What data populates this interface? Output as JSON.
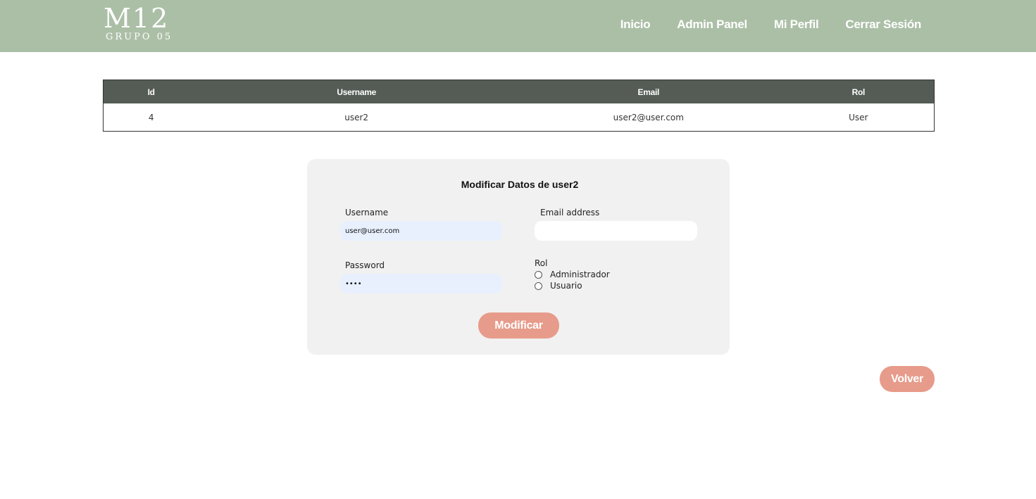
{
  "header": {
    "logo_main": "M12",
    "logo_sub": "GRUPO 05",
    "nav": [
      "Inicio",
      "Admin Panel",
      "Mi Perfil",
      "Cerrar Sesión"
    ]
  },
  "table": {
    "headers": [
      "Id",
      "Username",
      "Email",
      "Rol"
    ],
    "rows": [
      [
        "4",
        "user2",
        "user2@user.com",
        "User"
      ]
    ]
  },
  "form": {
    "title": "Modificar Datos de user2",
    "username_label": "Username",
    "username_value": "user@user.com",
    "email_label": "Email address",
    "email_value": "",
    "password_label": "Password",
    "password_value": "••••",
    "rol_label": "Rol",
    "rol_options": [
      "Administrador",
      "Usuario"
    ],
    "submit_label": "Modificar"
  },
  "back_label": "Volver",
  "colors": {
    "header_bg": "#abbfa6",
    "table_header_bg": "#545c55",
    "button_bg": "#e79b8a",
    "card_bg": "#f1f1f1",
    "autofill_bg": "#e8f0fe"
  }
}
